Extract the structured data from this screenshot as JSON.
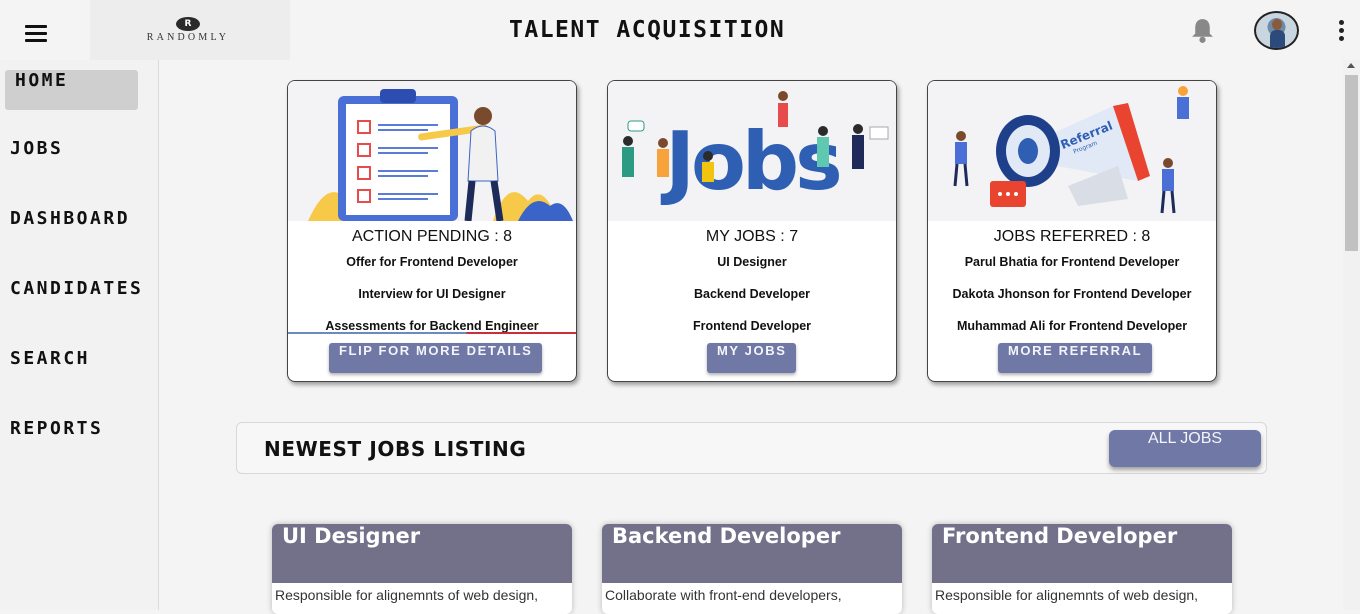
{
  "header": {
    "logo_text": "RANDOMLY",
    "logo_mark": "R",
    "title": "TALENT ACQUISITION",
    "menu_icon": "hamburger-icon",
    "notification_icon": "bell-icon",
    "more_icon": "kebab-icon"
  },
  "sidebar": {
    "items": [
      {
        "label": "HOME",
        "active": true
      },
      {
        "label": "JOBS"
      },
      {
        "label": "DASHBOARD"
      },
      {
        "label": "CANDIDATES"
      },
      {
        "label": "SEARCH"
      },
      {
        "label": "REPORTS"
      }
    ]
  },
  "cards": [
    {
      "title": "ACTION PENDING : 8",
      "lines": [
        "Offer for Frontend Developer",
        "Interview for UI Designer",
        "Assessments for Backend Engineer"
      ],
      "button": "FLIP FOR MORE DETAILS"
    },
    {
      "title": "MY JOBS : 7",
      "lines": [
        "UI Designer",
        "Backend Developer",
        "Frontend Developer"
      ],
      "button": "MY JOBS",
      "image_word": "Jobs"
    },
    {
      "title": "JOBS REFERRED : 8",
      "lines": [
        "Parul Bhatia for Frontend Developer",
        "Dakota Jhonson for Frontend Developer",
        "Muhammad Ali for Frontend Developer"
      ],
      "button": "MORE REFERRAL",
      "image_word": "Referral",
      "image_subword": "Program"
    }
  ],
  "listing": {
    "title": "NEWEST JOBS LISTING",
    "all_jobs_label": "ALL JOBS"
  },
  "jobs": [
    {
      "title": "UI Designer",
      "description": "Responsible for alignemnts of web design,"
    },
    {
      "title": "Backend Developer",
      "description": "Collaborate with front-end developers,"
    },
    {
      "title": "Frontend Developer",
      "description": "Responsible for alignemnts of web design,"
    }
  ],
  "colors": {
    "accent_button": "#7079a6",
    "job_header": "#73708a",
    "active_nav": "#cfcfcf"
  }
}
